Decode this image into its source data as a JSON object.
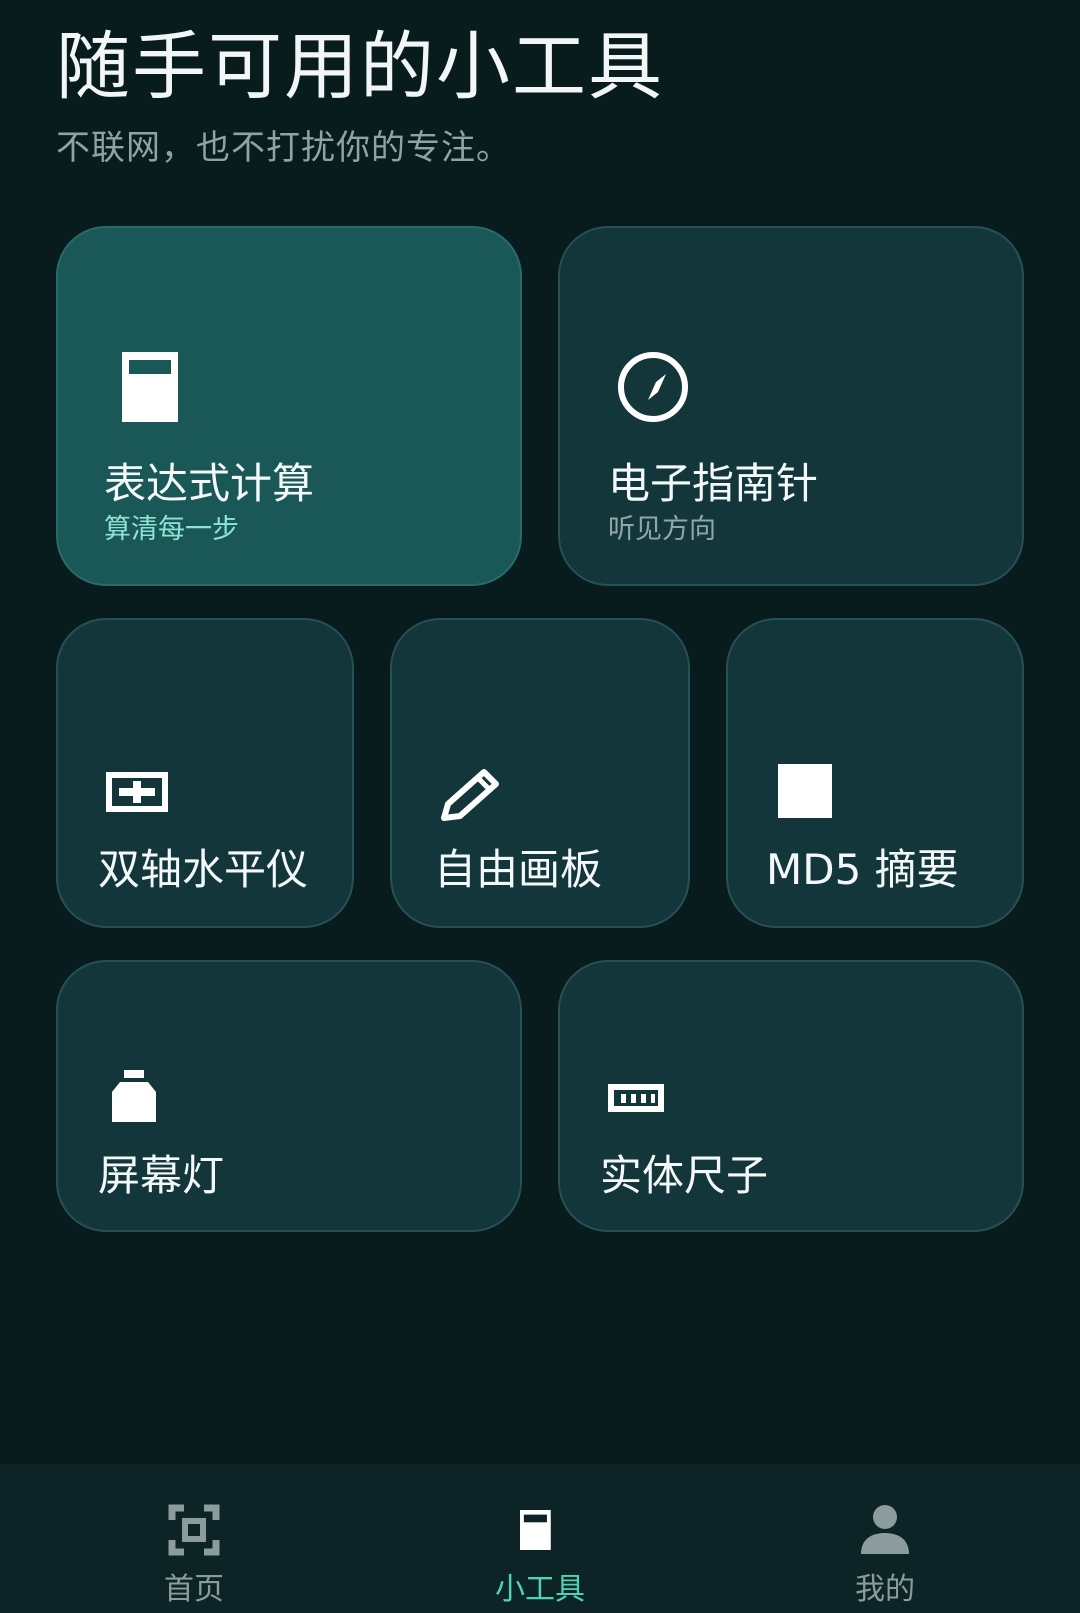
{
  "header": {
    "title": "随手可用的小工具",
    "subtitle": "不联网，也不打扰你的专注。"
  },
  "tools": {
    "expression_calc": {
      "label": "表达式计算",
      "sub": "算清每一步",
      "icon": "calculator-icon"
    },
    "compass": {
      "label": "电子指南针",
      "sub": "听见方向",
      "icon": "compass-icon"
    },
    "level": {
      "label": "双轴水平仪",
      "icon": "level-icon"
    },
    "canvas": {
      "label": "自由画板",
      "icon": "pencil-icon"
    },
    "md5": {
      "label": "MD5 摘要",
      "icon": "square-icon"
    },
    "screen_light": {
      "label": "屏幕灯",
      "icon": "light-icon"
    },
    "ruler": {
      "label": "实体尺子",
      "icon": "ruler-icon"
    }
  },
  "nav": {
    "home": {
      "label": "首页",
      "icon": "scan-icon"
    },
    "tools": {
      "label": "小工具",
      "icon": "calculator-icon"
    },
    "me": {
      "label": "我的",
      "icon": "person-icon"
    }
  },
  "colors": {
    "background": "#081c1e",
    "card": "#13363b",
    "card_active": "#1a5858",
    "accent": "#4fd3b4"
  }
}
